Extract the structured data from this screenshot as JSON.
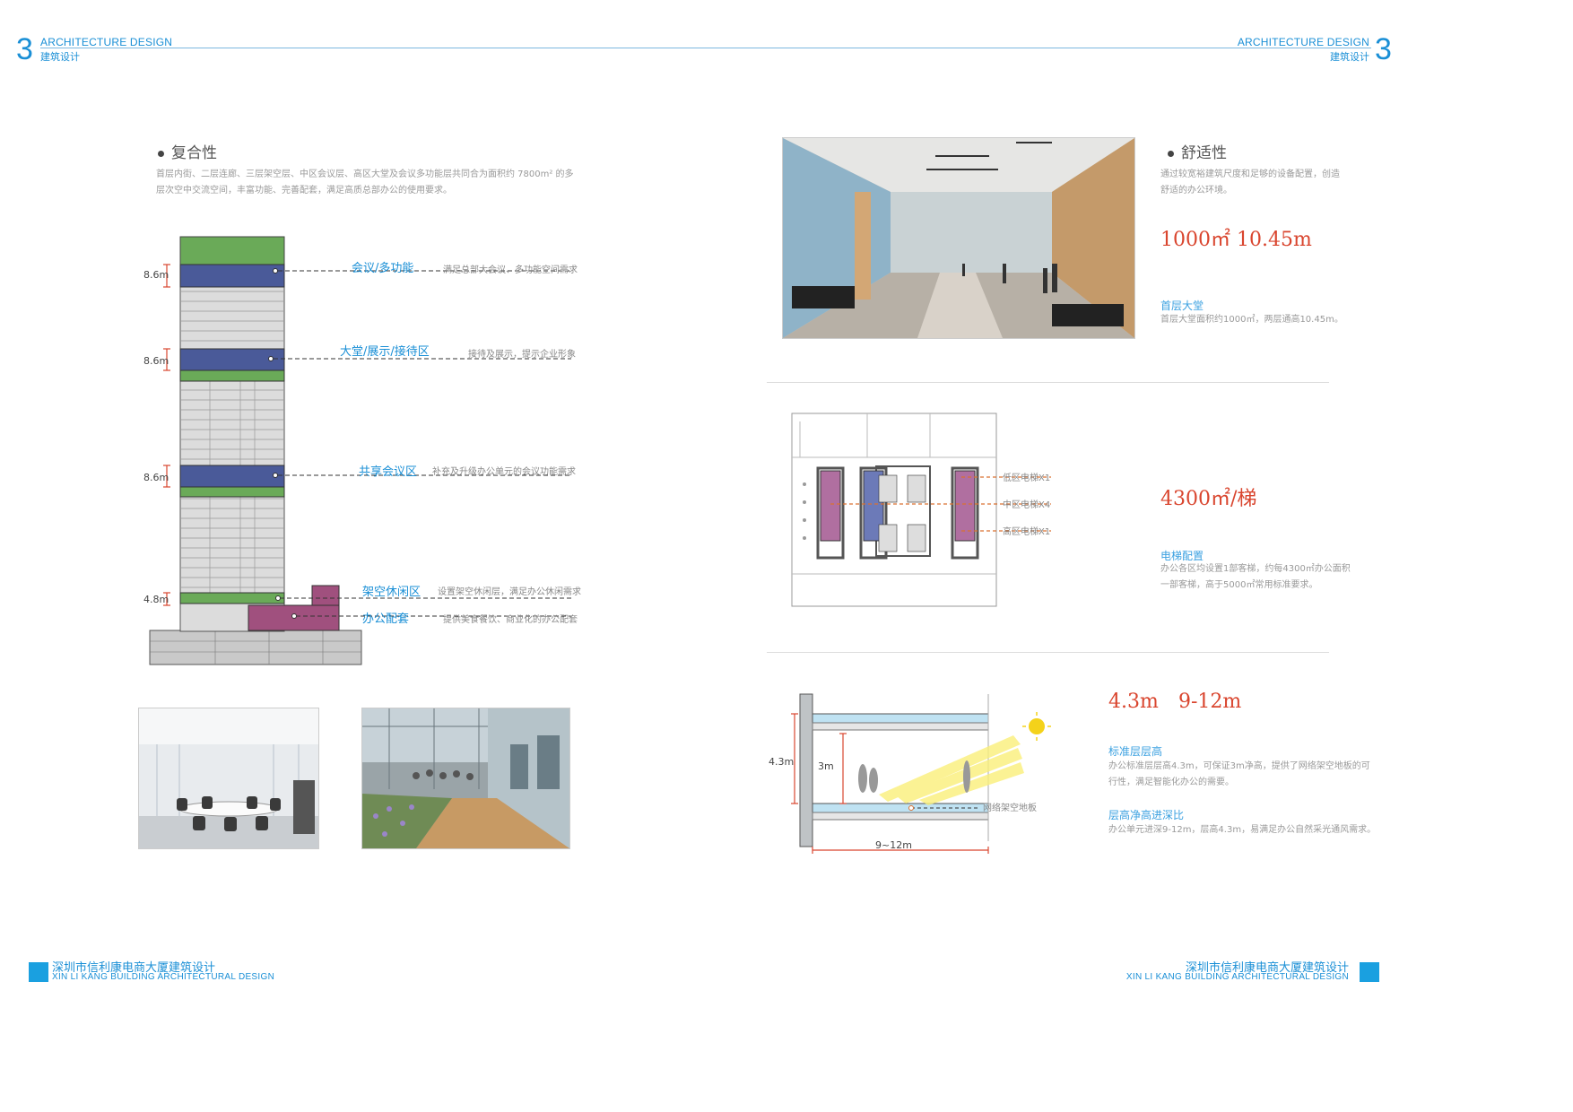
{
  "header": {
    "left": {
      "number": "3",
      "en": "ARCHITECTURE DESIGN",
      "cn": "建筑设计"
    },
    "right": {
      "number": "3",
      "en": "ARCHITECTURE DESIGN",
      "cn": "建筑设计"
    }
  },
  "left_page": {
    "section_title": "复合性",
    "intro_lines": [
      "首层内街、二层连廊、三层架空层、中区会议层、高区大堂及会议多功能层共同合为面积约 7800m² 的多",
      "层次空中交流空间，丰富功能、完善配套，满足高质总部办公的使用要求。"
    ],
    "section_diagram": {
      "heights": [
        "8.6m",
        "8.6m",
        "8.6m",
        "4.8m"
      ],
      "callouts": [
        {
          "label": "会议/多功能",
          "note": "满足总部大会议、多功能空间需求"
        },
        {
          "label": "大堂/展示/接待区",
          "note": "接待及展示，提示企业形象"
        },
        {
          "label": "共享会议区",
          "note": "补充及升级办公单元的会议功能需求"
        },
        {
          "label": "架空休闲区",
          "note": "设置架空休闲层，满足办公休闲需求"
        },
        {
          "label": "办公配套",
          "note": "提供美食餐饮、商业化的办公配套"
        }
      ]
    }
  },
  "right_page": {
    "comfort": {
      "title": "舒适性",
      "intro_lines": [
        "通过较宽裕建筑尺度和足够的设备配置，创造",
        "舒适的办公环境。"
      ],
      "big_value": "1000㎡  10.45m",
      "sub_title": "首层大堂",
      "sub_text": "首层大堂面积约1000㎡，两层通高10.45m。"
    },
    "elevator": {
      "labels": [
        "低区电梯X1",
        "中区电梯X4",
        "高区电梯X1"
      ],
      "big_value": "4300㎡/梯",
      "sub_title": "电梯配置",
      "sub_lines": [
        "办公各区均设置1部客梯，约每4300㎡办公面积",
        "一部客梯，高于5000㎡常用标准要求。"
      ]
    },
    "floor": {
      "big_values": [
        "4.3m",
        "9-12m"
      ],
      "dims": {
        "floor_height": "4.3m",
        "clear": "3m",
        "depth": "9~12m"
      },
      "raised_floor_label": "网络架空地板",
      "sub_title_1": "标准层层高",
      "sub_lines_1": [
        "办公标准层层高4.3m，可保证3m净高，提供了网络架空地板的可",
        "行性，满足智能化办公的需要。"
      ],
      "sub_title_2": "层高净高进深比",
      "sub_lines_2": [
        "办公单元进深9-12m，层高4.3m，易满足办公自然采光通风需求。"
      ]
    }
  },
  "footer": {
    "left": {
      "cn": "深圳市信利康电商大厦建筑设计",
      "en": "XIN LI KANG BUILDING ARCHITECTURAL DESIGN"
    },
    "right": {
      "cn": "深圳市信利康电商大厦建筑设计",
      "en": "XIN LI KANG BUILDING ARCHITECTURAL DESIGN"
    }
  },
  "colors": {
    "accent": "#1a8fd6",
    "green": "#6aaa58",
    "navy": "#4a5a99",
    "magenta": "#a0507e",
    "red": "#d9452e"
  }
}
